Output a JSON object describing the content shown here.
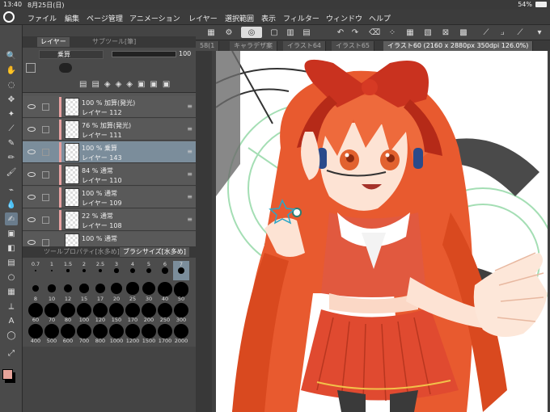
{
  "status": {
    "time": "13:40",
    "date": "8月25日(日)",
    "battery": "54%"
  },
  "menu": [
    "ファイル",
    "編集",
    "ページ管理",
    "アニメーション",
    "レイヤー",
    "選択範囲",
    "表示",
    "フィルター",
    "ウィンドウ",
    "ヘルプ"
  ],
  "layer_panel": {
    "tab_label": "レイヤー",
    "sub_tool_tab": "サブツール[筆]",
    "blend_mode": "乗算",
    "opacity": "100"
  },
  "layers": [
    {
      "mode": "100 % 加算(発光)",
      "name": "レイヤー 112",
      "selected": false
    },
    {
      "mode": "76 % 加算(発光)",
      "name": "レイヤー 111",
      "selected": false
    },
    {
      "mode": "100 % 乗算",
      "name": "レイヤー 143",
      "selected": true
    },
    {
      "mode": "84 % 通常",
      "name": "レイヤー 110",
      "selected": false
    },
    {
      "mode": "100 % 通常",
      "name": "レイヤー 109",
      "selected": false
    },
    {
      "mode": "22 % 通常",
      "name": "レイヤー 108",
      "selected": false
    },
    {
      "mode": "100 % 通常",
      "name": "",
      "selected": false
    }
  ],
  "tool_property_tab": "ツールプロパティ[水多め]",
  "brush_size_tab": "ブラシサイズ[水多め]",
  "brush_sizes": [
    "0.7",
    "1",
    "1.5",
    "2",
    "2.5",
    "3",
    "4",
    "5",
    "6",
    "7",
    "8",
    "10",
    "12",
    "15",
    "17",
    "20",
    "25",
    "30",
    "40",
    "50",
    "60",
    "70",
    "80",
    "100",
    "120",
    "150",
    "170",
    "200",
    "250",
    "300",
    "400",
    "500",
    "600",
    "700",
    "800",
    "1000",
    "1200",
    "1500",
    "1700",
    "2000"
  ],
  "selected_brush_size": "7",
  "doc_tabs": [
    "58(1",
    "キャラデザ案",
    "イラスト64",
    "イラスト65",
    "イラスト60 (2160 x 2880px 350dpi 126.0%)"
  ],
  "colors": {
    "main": "#e8a49b",
    "sub": "#000000",
    "accent_selected": "#7b8d9b"
  }
}
